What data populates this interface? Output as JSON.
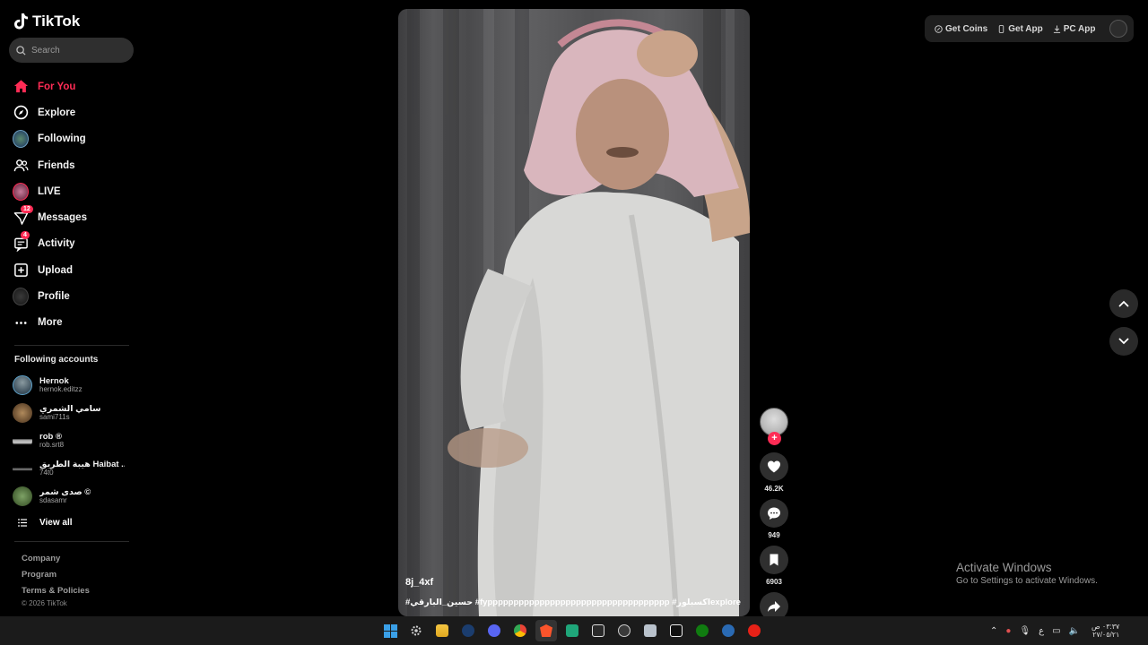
{
  "app": {
    "logo_text": "TikTok"
  },
  "search": {
    "placeholder": "Search"
  },
  "nav": [
    {
      "label": "For You",
      "icon": "home-icon",
      "active": true
    },
    {
      "label": "Explore",
      "icon": "compass-icon"
    },
    {
      "label": "Following",
      "icon": "following-avatar-icon"
    },
    {
      "label": "Friends",
      "icon": "friends-icon"
    },
    {
      "label": "LIVE",
      "icon": "live-avatar-icon"
    },
    {
      "label": "Messages",
      "icon": "messages-icon",
      "badge": "12"
    },
    {
      "label": "Activity",
      "icon": "activity-icon",
      "badge": "4"
    },
    {
      "label": "Upload",
      "icon": "upload-icon"
    },
    {
      "label": "Profile",
      "icon": "profile-avatar-icon"
    },
    {
      "label": "More",
      "icon": "more-icon"
    }
  ],
  "following": {
    "title": "Following accounts",
    "accounts": [
      {
        "name": "Hernok",
        "handle": "hernok.editzz"
      },
      {
        "name": "سامي الشمري",
        "handle": "sami711s"
      },
      {
        "name": "rob ®",
        "handle": "rob.srt8"
      },
      {
        "name": "هيبة الطريق Haibat ...",
        "handle": "74t0"
      },
      {
        "name": "صدى شمر ©",
        "handle": "sdasamr"
      }
    ],
    "view_all": "View all"
  },
  "footer": {
    "links": [
      "Company",
      "Program",
      "Terms & Policies"
    ],
    "copyright": "© 2026 TikTok"
  },
  "video": {
    "username": "8j_4xf",
    "caption": "#حسين_البارقي #fyppppppppppppppppppppppppppppppppppp #اكسبلورexplore"
  },
  "actions": {
    "likes": "46.2K",
    "comments": "949",
    "saves": "6903"
  },
  "topbar": {
    "get_coins": "Get Coins",
    "get_app": "Get App",
    "pc_app": "PC App"
  },
  "watermark": {
    "title": "Activate Windows",
    "subtitle": "Go to Settings to activate Windows."
  },
  "taskbar": {
    "lang": "ع",
    "time": "٠٣:٣٧ ص",
    "date": "٢٧/٠٥/٢١"
  },
  "colors": {
    "accent": "#fe2c55",
    "background": "#000000"
  }
}
